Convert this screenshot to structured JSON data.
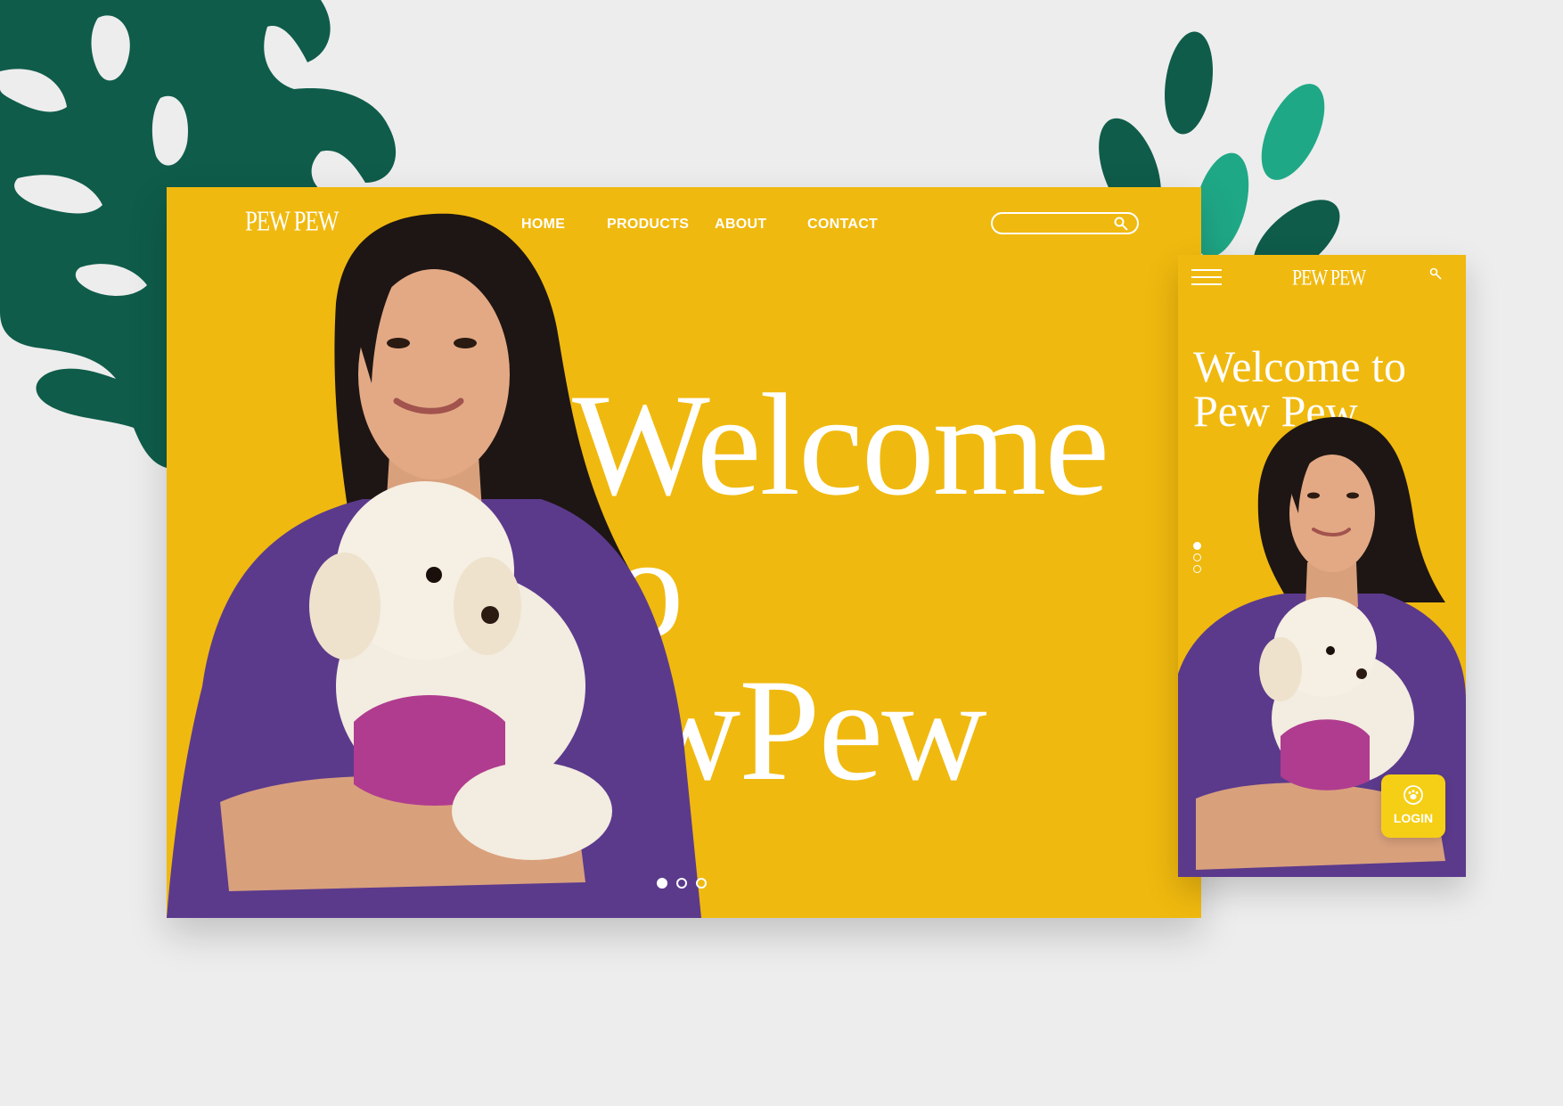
{
  "desktop": {
    "logo": "PEW PEW",
    "nav": [
      "HOME",
      "PRODUCTS",
      "ABOUT",
      "CONTACT"
    ],
    "search": {
      "placeholder": "",
      "icon": "search-icon"
    },
    "hero_lines": [
      "Welcome",
      "to",
      "ewPew"
    ],
    "carousel": {
      "count": 3,
      "active": 1
    }
  },
  "mobile": {
    "menu_icon": "hamburger-menu-icon",
    "logo": "PEW PEW",
    "search_icon": "search-icon",
    "hero_lines": [
      "Welcome to",
      "Pew Pew"
    ],
    "carousel": {
      "count": 3,
      "active": 1
    },
    "login": {
      "label": "LOGIN",
      "icon": "paw-icon"
    }
  },
  "colors": {
    "background": "#ededed",
    "brand_yellow": "#f0b90f",
    "login_yellow": "#f5cf16",
    "leaf_dark_green": "#0f5c4a",
    "leaf_teal": "#1fa886",
    "shirt_purple": "#5b3a8c"
  }
}
